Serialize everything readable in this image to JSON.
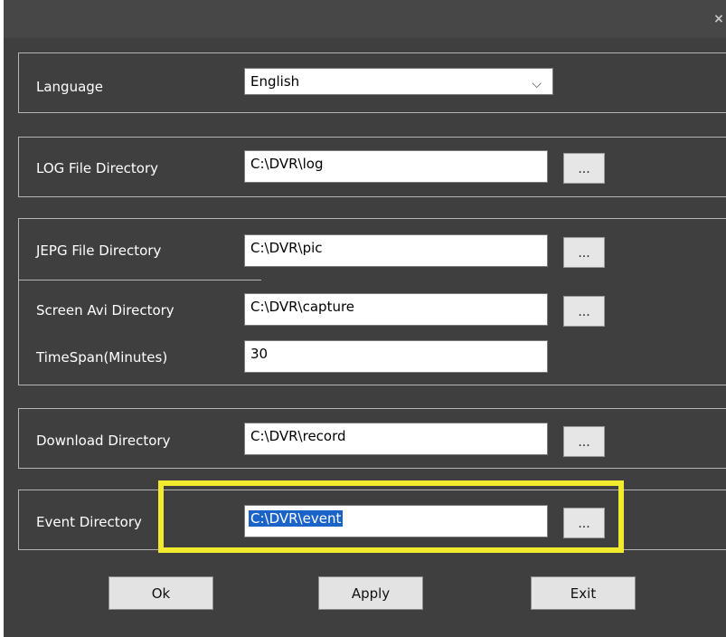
{
  "window": {
    "close_label": "×"
  },
  "language": {
    "label": "Language",
    "value": "English"
  },
  "log_dir": {
    "label": "LOG File Directory",
    "value": "C:\\DVR\\log",
    "browse_label": "..."
  },
  "jpeg_dir": {
    "label": "JEPG File Directory",
    "value": "C:\\DVR\\pic",
    "browse_label": "..."
  },
  "avi_dir": {
    "label": "Screen Avi Directory",
    "value": "C:\\DVR\\capture",
    "browse_label": "..."
  },
  "timespan": {
    "label": "TimeSpan(Minutes)",
    "value": "30"
  },
  "download_dir": {
    "label": "Download Directory",
    "value": "C:\\DVR\\record",
    "browse_label": "..."
  },
  "event_dir": {
    "label": "Event Directory",
    "value": "C:\\DVR\\event",
    "browse_label": "..."
  },
  "buttons": {
    "ok": "Ok",
    "apply": "Apply",
    "exit": "Exit"
  },
  "colors": {
    "background": "#3f3f3f",
    "highlight": "#f2ea2c",
    "selection": "#1a63c8"
  }
}
